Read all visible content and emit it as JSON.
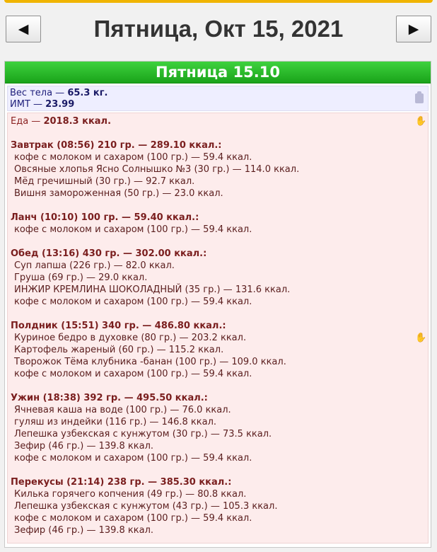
{
  "header": {
    "date_title": "Пятница, Окт 15, 2021",
    "prev_glyph": "◀",
    "next_glyph": "▶"
  },
  "day": {
    "title": "Пятница 15.10"
  },
  "body": {
    "weight_label": "Вес тела — ",
    "weight_value": "65.3 кг.",
    "bmi_label": "ИМТ — ",
    "bmi_value": "23.99"
  },
  "food": {
    "total_label": "Еда — ",
    "total_value": "2018.3 ккал.",
    "meals": [
      {
        "title": "Завтрак (08:56) 210 гр. — 289.10 ккал.:",
        "items": [
          "кофе с молоком и сахаром (100 гр.) — 59.4 ккал.",
          "Овсяные хлопья Ясно Солнышко №3 (30 гр.) — 114.0 ккал.",
          "Мёд гречишный (30 гр.) — 92.7 ккал.",
          "Вишня замороженная (50 гр.) — 23.0 ккал."
        ]
      },
      {
        "title": "Ланч (10:10) 100 гр. — 59.40 ккал.:",
        "items": [
          "кофе с молоком и сахаром (100 гр.) — 59.4 ккал."
        ]
      },
      {
        "title": "Обед (13:16) 430 гр. — 302.00 ккал.:",
        "items": [
          "Суп лапша (226 гр.) — 82.0 ккал.",
          "Груша (69 гр.) — 29.0 ккал.",
          "ИНЖИР КРЕМЛИНА ШОКОЛАДНЫЙ (35 гр.) — 131.6 ккал.",
          "кофе с молоком и сахаром (100 гр.) — 59.4 ккал."
        ]
      },
      {
        "title": "Полдник (15:51) 340 гр. — 486.80 ккал.:",
        "items": [
          "Куриное бедро в духовке (80 гр.) — 203.2 ккал.",
          "Картофель жареный (60 гр.) — 115.2 ккал.",
          "Творожок Тёма клубника -банан (100 гр.) — 109.0 ккал.",
          "кофе с молоком и сахаром (100 гр.) — 59.4 ккал."
        ]
      },
      {
        "title": "Ужин (18:38) 392 гр. — 495.50 ккал.:",
        "items": [
          "Ячневая каша на воде (100 гр.) — 76.0 ккал.",
          "гуляш из индейки (116 гр.) — 146.8 ккал.",
          "Лепешка узбекская с кунжутом (30 гр.) — 73.5 ккал.",
          "Зефир (46 гр.) — 139.8 ккал.",
          "кофе с молоком и сахаром (100 гр.) — 59.4 ккал."
        ]
      },
      {
        "title": "Перекусы (21:14) 238 гр. — 385.30 ккал.:",
        "items": [
          "Килька горячего копчения (49 гр.) — 80.8 ккал.",
          "Лепешка узбекская с кунжутом (43 гр.) — 105.3 ккал.",
          "кофе с молоком и сахаром (100 гр.) — 59.4 ккал.",
          "Зефир (46 гр.) — 139.8 ккал."
        ]
      }
    ]
  }
}
